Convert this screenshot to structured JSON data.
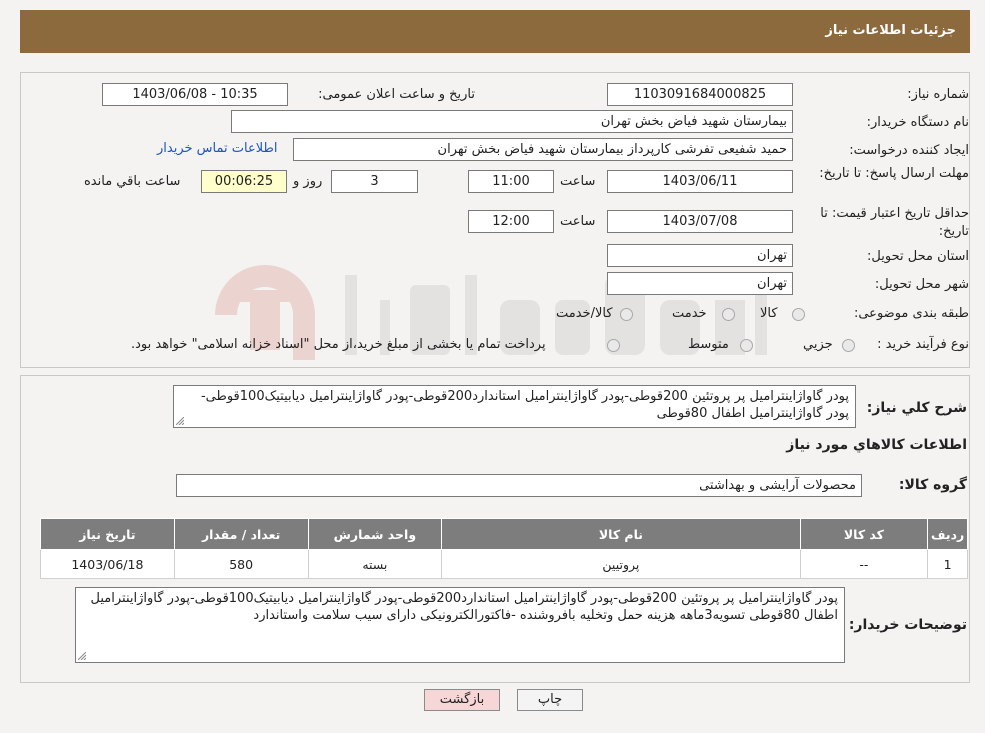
{
  "header": {
    "title": "جزئیات اطلاعات نیاز"
  },
  "form": {
    "need_number_label": "شماره نیاز:",
    "need_number": "1103091684000825",
    "announce_label": "تاریخ و ساعت اعلان عمومی:",
    "announce_value": "1403/06/08 - 10:35",
    "buyer_org_label": "نام دستگاه خریدار:",
    "buyer_org": "بیمارستان شهید فیاض بخش تهران",
    "requester_label": "ایجاد کننده درخواست:",
    "requester": "حمید شفیعی تفرشی کارپرداز بیمارستان شهید فیاض بخش تهران",
    "contact_link": "اطلاعات تماس خریدار",
    "deadline_label": "مهلت ارسال پاسخ: تا تاریخ:",
    "deadline_date": "1403/06/11",
    "time_label": "ساعت",
    "deadline_time": "11:00",
    "days_value": "3",
    "days_label": "روز و",
    "remaining_time": "00:06:25",
    "remaining_label": "ساعت باقي مانده",
    "price_valid_label": "حداقل تاریخ اعتبار قیمت: تا تاریخ:",
    "price_valid_date": "1403/07/08",
    "price_valid_time": "12:00",
    "province_label": "استان محل تحویل:",
    "province": "تهران",
    "city_label": "شهر محل تحویل:",
    "city": "تهران",
    "category_label": "طبقه بندی موضوعی:",
    "category_options": [
      "کالا",
      "خدمت",
      "کالا/خدمت"
    ],
    "process_label": "نوع فرآیند خرید :",
    "process_options": [
      "جزیي",
      "متوسط"
    ],
    "process_note": "پرداخت تمام یا بخشی از مبلغ خرید،از محل \"اسناد خزانه اسلامی\" خواهد بود."
  },
  "summary": {
    "label": "شرح کلي نیاز:",
    "text": "پودر گاواژاینترامیل پر پروتئین 200قوطی-پودر گاواژاینترامیل استاندارد200قوطی-پودر گاواژاینترامیل دیابیتیک100قوطی-پودر گاواژاینترامیل  اطفال 80قوطی"
  },
  "goods_section": {
    "title": "اطلاعات کالاهاي مورد نیاز",
    "group_label": "گروه کالا:",
    "group_value": "محصولات آرایشی و بهداشتی"
  },
  "table": {
    "headers": [
      "ردیف",
      "کد کالا",
      "نام کالا",
      "واحد شمارش",
      "تعداد / مقدار",
      "تاریخ نیاز"
    ],
    "rows": [
      [
        "1",
        "--",
        "پروتیین",
        "بسته",
        "580",
        "1403/06/18"
      ]
    ]
  },
  "buyer_notes": {
    "label": "توضیحات خریدار:",
    "text": "پودر گاواژاینترامیل پر پروتئین 200قوطی-پودر گاواژاینترامیل استاندارد200قوطی-پودر گاواژاینترامیل دیابیتیک100قوطی-پودر گاواژاینترامیل  اطفال 80قوطی تسویه3ماهه هزینه حمل وتخلیه بافروشنده -فاکتورالکترونیکی دارای سیب سلامت واستاندارد"
  },
  "buttons": {
    "print": "چاپ",
    "back": "بازگشت"
  },
  "colors": {
    "header_bg": "#8c6a3d",
    "table_header_bg": "#7d7d7d",
    "back_button_bg": "#f6d6d6"
  }
}
